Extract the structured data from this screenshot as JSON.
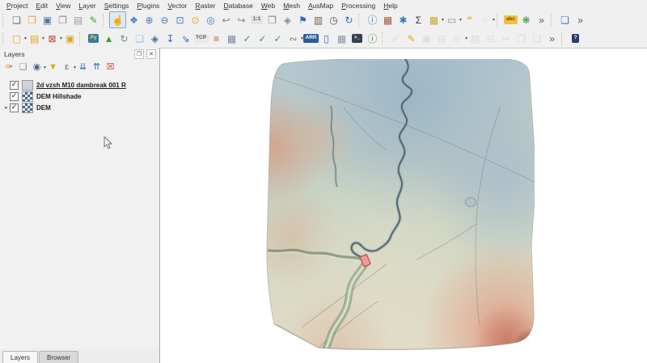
{
  "app": {
    "name": "QGIS"
  },
  "menu_bar": {
    "items": [
      "Project",
      "Edit",
      "View",
      "Layer",
      "Settings",
      "Plugins",
      "Vector",
      "Raster",
      "Database",
      "Web",
      "Mesh",
      "AusMap",
      "Processing",
      "Help"
    ]
  },
  "toolbar_primary": {
    "items": [
      {
        "type": "grip"
      },
      {
        "name": "new-project",
        "glyph": "❏",
        "color": "#6a6a6a"
      },
      {
        "name": "open-project",
        "glyph": "❒",
        "color": "#dfa33c"
      },
      {
        "name": "save-project",
        "glyph": "▣",
        "color": "#54769e"
      },
      {
        "name": "new-print-layout",
        "glyph": "❐",
        "color": "#8a8a8a"
      },
      {
        "name": "layout-manager",
        "glyph": "▤",
        "color": "#9a9a9a"
      },
      {
        "name": "style-manager",
        "glyph": "✎",
        "color": "#4c9a48"
      },
      {
        "type": "grip"
      },
      {
        "name": "pan-map",
        "glyph": "☝",
        "color": "#3b3b3b",
        "pressed": true
      },
      {
        "name": "pan-to-selection",
        "glyph": "❖",
        "color": "#3a7abd"
      },
      {
        "name": "zoom-in",
        "glyph": "⊕",
        "color": "#3a7abd"
      },
      {
        "name": "zoom-out",
        "glyph": "⊖",
        "color": "#3a7abd"
      },
      {
        "name": "zoom-full",
        "glyph": "⊡",
        "color": "#3a7abd"
      },
      {
        "name": "zoom-to-selection",
        "glyph": "⊙",
        "color": "#d8a820"
      },
      {
        "name": "zoom-to-layer",
        "glyph": "◎",
        "color": "#3a7abd"
      },
      {
        "name": "zoom-last",
        "glyph": "↩",
        "color": "#888888"
      },
      {
        "name": "zoom-next",
        "glyph": "↪",
        "color": "#888888"
      },
      {
        "name": "zoom-native",
        "badge": {
          "text": "1:1",
          "bg": "#e3e3e3",
          "fg": "#555555"
        }
      },
      {
        "name": "new-map-view",
        "glyph": "❒",
        "color": "#6f9a6f"
      },
      {
        "name": "new-3d-map-view",
        "glyph": "◈",
        "color": "#8a8a8a"
      },
      {
        "name": "new-spatial-bookmark",
        "glyph": "⚑",
        "color": "#2a6abd"
      },
      {
        "name": "show-bookmarks",
        "glyph": "▥",
        "color": "#7a5a3a"
      },
      {
        "name": "temporal-controller",
        "glyph": "◷",
        "color": "#555555"
      },
      {
        "name": "refresh-map",
        "glyph": "↻",
        "color": "#2a6abd"
      },
      {
        "type": "grip"
      },
      {
        "name": "identify-features",
        "glyph": "ⓘ",
        "color": "#2a7abd"
      },
      {
        "name": "statistics-panel",
        "glyph": "▦",
        "color": "#a05838"
      },
      {
        "name": "options",
        "glyph": "✱",
        "color": "#3a7abd"
      },
      {
        "name": "show-statistical-summary",
        "glyph": "Σ",
        "color": "#333333"
      },
      {
        "name": "open-field-calculator",
        "glyph": "▦",
        "color": "#c8a830",
        "dropdown": true
      },
      {
        "name": "measure",
        "glyph": "▭",
        "color": "#8a93a0",
        "dropdown": true
      },
      {
        "name": "map-tips",
        "glyph": "❝",
        "color": "#e8b93c"
      },
      {
        "name": "nominatim-search",
        "glyph": "○",
        "color": "#bbbbbb",
        "dropdown": true,
        "disabled": true
      },
      {
        "type": "grip"
      },
      {
        "name": "layer-labeling",
        "badge": {
          "text": "abc",
          "bg": "#f0c040",
          "fg": "#6a4a00"
        }
      },
      {
        "name": "layer-diagram",
        "glyph": "❋",
        "color": "#3aa03a"
      },
      {
        "name": "toolbar-overflow-a",
        "glyph": "»",
        "color": "#555555"
      },
      {
        "type": "grip"
      },
      {
        "name": "duplicate-layers",
        "glyph": "❏",
        "color": "#3a7abd"
      },
      {
        "name": "toolbar-overflow-b",
        "glyph": "»",
        "color": "#555555"
      }
    ]
  },
  "toolbar_secondary": {
    "items": [
      {
        "type": "grip"
      },
      {
        "name": "select-features",
        "glyph": "▢",
        "color": "#d8a820",
        "dropdown": true
      },
      {
        "name": "select-by-form",
        "glyph": "▤",
        "color": "#d8a820",
        "dropdown": true
      },
      {
        "name": "deselect-features",
        "glyph": "⊠",
        "color": "#c84838",
        "dropdown": true
      },
      {
        "name": "select-by-value",
        "glyph": "▣",
        "color": "#d8a820"
      },
      {
        "type": "grip"
      },
      {
        "name": "python-console",
        "badge": {
          "text": "Py",
          "bg": "#3a78a8",
          "fg": "#ffd83a"
        }
      },
      {
        "name": "terrain-tools",
        "glyph": "▲",
        "color": "#4a9a3a"
      },
      {
        "name": "processing-history",
        "glyph": "↻",
        "color": "#6a8a9a"
      },
      {
        "name": "model-designer",
        "glyph": "❑",
        "color": "#9cc0dc"
      },
      {
        "name": "georeferencer",
        "glyph": "◈",
        "color": "#4a6a8a"
      },
      {
        "name": "import-layer",
        "glyph": "↧",
        "color": "#2a6abd"
      },
      {
        "name": "export-layer",
        "glyph": "⇘",
        "color": "#2a6abd"
      },
      {
        "name": "tcp-connection",
        "badge": {
          "text": "TCP",
          "bg": "#e8e8e8",
          "fg": "#555555"
        }
      },
      {
        "name": "layer-styles",
        "glyph": "≡",
        "color": "#c06020"
      },
      {
        "name": "raster-image-tool",
        "glyph": "▦",
        "color": "#7a8a9a"
      },
      {
        "name": "check-geometry",
        "glyph": "✓",
        "color": "#3aa03a"
      },
      {
        "name": "check-validity",
        "glyph": "✓",
        "color": "#3aa03a"
      },
      {
        "name": "topology-checker",
        "glyph": "✓",
        "color": "#3aa03a"
      },
      {
        "name": "attachments",
        "glyph": "∾",
        "color": "#777777",
        "dropdown": true
      },
      {
        "name": "arr-data-tool",
        "badge": {
          "text": "ARR",
          "bg": "#2a5a9a",
          "fg": "#ffffff"
        }
      },
      {
        "name": "notes-document",
        "glyph": "▯",
        "color": "#3a6aa8"
      },
      {
        "name": "grid-tool",
        "glyph": "▦",
        "color": "#8898a8"
      },
      {
        "name": "os-console",
        "badge": {
          "text": ">_",
          "bg": "#33404d",
          "fg": "#ffffff"
        }
      },
      {
        "name": "metadata-info",
        "glyph": "ⓘ",
        "color": "#2a9a3a"
      },
      {
        "type": "grip"
      },
      {
        "name": "current-edits",
        "glyph": "✐",
        "color": "#bbbbbb",
        "disabled": true
      },
      {
        "name": "toggle-editing",
        "glyph": "✎",
        "color": "#d8a820"
      },
      {
        "name": "save-edits",
        "glyph": "▣",
        "color": "#c2c2c2",
        "disabled": true
      },
      {
        "name": "add-feature",
        "glyph": "⊞",
        "color": "#c2c2c2",
        "disabled": true
      },
      {
        "name": "vertex-tool",
        "glyph": "⊙",
        "color": "#c2c2c2",
        "dropdown": true,
        "disabled": true
      },
      {
        "name": "modify-attributes",
        "glyph": "▨",
        "color": "#c2c2c2",
        "disabled": true
      },
      {
        "name": "delete-selected",
        "glyph": "⊟",
        "color": "#c2c2c2",
        "disabled": true
      },
      {
        "name": "cut-features",
        "glyph": "✂",
        "color": "#bbbbbb",
        "disabled": true
      },
      {
        "name": "copy-features",
        "glyph": "❐",
        "color": "#bbbbbb",
        "disabled": true
      },
      {
        "name": "paste-features",
        "glyph": "❏",
        "color": "#bbbbbb",
        "disabled": true
      },
      {
        "name": "toolbar-overflow-c",
        "glyph": "»",
        "color": "#555555"
      },
      {
        "type": "grip"
      },
      {
        "name": "help",
        "badge": {
          "text": "?",
          "bg": "#2a3a7a",
          "fg": "#ffffff"
        }
      }
    ]
  },
  "layers_panel": {
    "title": "Layers",
    "window_buttons": [
      {
        "name": "panel-float",
        "glyph": "❐"
      },
      {
        "name": "panel-close",
        "glyph": "✕"
      }
    ],
    "toolbar": [
      {
        "name": "open-layer-styling",
        "glyph": "✑",
        "color": "#c06020"
      },
      {
        "name": "add-group",
        "glyph": "❏",
        "color": "#7a8a9a"
      },
      {
        "name": "manage-map-themes",
        "glyph": "◉",
        "color": "#50607a",
        "dropdown": true
      },
      {
        "name": "filter-legend",
        "glyph": "▼",
        "color": "#d8a820"
      },
      {
        "name": "filter-by-expression",
        "glyph": "ε",
        "color": "#5a6a7a",
        "dropdown": true
      },
      {
        "name": "expand-all",
        "glyph": "⇊",
        "color": "#2a6abd"
      },
      {
        "name": "collapse-all",
        "glyph": "⇈",
        "color": "#2a6abd"
      },
      {
        "name": "remove-layer",
        "glyph": "☒",
        "color": "#c03028"
      }
    ],
    "tree": [
      {
        "label": "2d vzsh M10 dambreak 001 R",
        "checked": true,
        "swatch": "mesh-gray",
        "selected": true,
        "expander": false
      },
      {
        "label": "DEM Hillshade",
        "checked": true,
        "swatch": "raster-checker",
        "selected": false,
        "expander": false
      },
      {
        "label": "DEM",
        "checked": true,
        "swatch": "raster-checker",
        "selected": false,
        "expander": true
      }
    ]
  },
  "bottom_tabs": {
    "tabs": [
      {
        "label": "Layers",
        "active": true
      },
      {
        "label": "Browser",
        "active": false
      }
    ]
  },
  "map": {
    "colors": {
      "elevation_low": "#9db7c8",
      "elevation_mid": "#ccd5c3",
      "elevation_high": "#e6dcc6",
      "elevation_peak": "#c87a64",
      "river": "#4f6068",
      "channel": "#62705c",
      "dam_marker_fill": "#ea9b9b",
      "dam_marker_stroke": "#bc4a44",
      "canvas_background": "#ffffff"
    }
  }
}
